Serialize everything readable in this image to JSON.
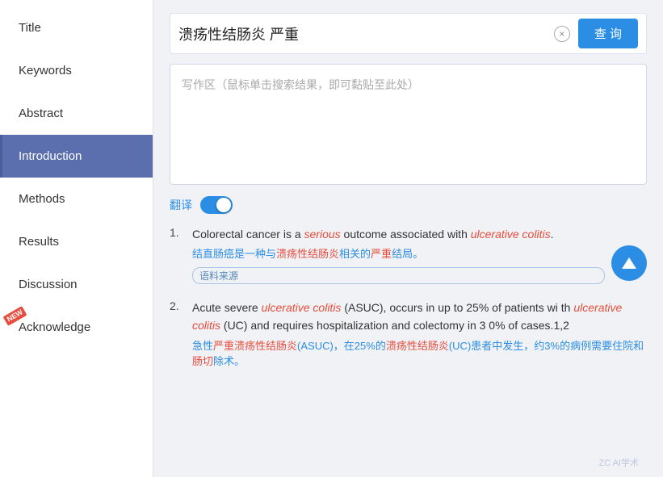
{
  "sidebar": {
    "items": [
      {
        "id": "title",
        "label": "Title",
        "active": false,
        "new": false
      },
      {
        "id": "keywords",
        "label": "Keywords",
        "active": false,
        "new": false
      },
      {
        "id": "abstract",
        "label": "Abstract",
        "active": false,
        "new": false
      },
      {
        "id": "introduction",
        "label": "Introduction",
        "active": true,
        "new": false
      },
      {
        "id": "methods",
        "label": "Methods",
        "active": false,
        "new": false
      },
      {
        "id": "results",
        "label": "Results",
        "active": false,
        "new": false
      },
      {
        "id": "discussion",
        "label": "Discussion",
        "active": false,
        "new": false
      },
      {
        "id": "acknowledge",
        "label": "Acknowledge",
        "active": false,
        "new": true
      }
    ]
  },
  "search": {
    "query": "溃疡性结肠炎 严重",
    "clear_label": "×",
    "query_btn_label": "查 询",
    "writing_placeholder": "写作区（鼠标单击搜索结果，即可黏贴至此处）"
  },
  "translate": {
    "label": "翻译"
  },
  "results": [
    {
      "number": "1.",
      "en_parts": [
        {
          "text": "Colorectal cancer is a ",
          "type": "normal"
        },
        {
          "text": "serious",
          "type": "em-serious"
        },
        {
          "text": " outcome associated with ",
          "type": "normal"
        },
        {
          "text": "ulcerative colitis",
          "type": "em-uc"
        },
        {
          "text": ".",
          "type": "normal"
        }
      ],
      "en_full": "Colorectal cancer is a serious outcome associated with ulcerative colitis.",
      "zh": "结直肠癌是一种与溃疡性结肠炎相关的严重结局。",
      "source": "语料来源"
    },
    {
      "number": "2.",
      "en_parts": [
        {
          "text": "Acute severe ",
          "type": "normal"
        },
        {
          "text": "ulcerative colitis",
          "type": "em-uc"
        },
        {
          "text": " (ASUC), occurs in up to 25% of patients with ",
          "type": "normal"
        },
        {
          "text": "ulcerative colitis",
          "type": "em-uc"
        },
        {
          "text": " (UC) and requires hospitalization and colectomy in 30% of cases.1,2",
          "type": "normal"
        }
      ],
      "en_full": "Acute severe ulcerative colitis (ASUC), occurs in up to 25% of patients with ulcerative colitis (UC) and requires hospitalization and colectomy in 30% of cases.1,2",
      "zh": "急性严重溃疡性结肠炎(ASUC)，在25%的溃疡性结肠炎(UC)患者中发生，约3%的病例需要住院和肠切除术。",
      "source": ""
    }
  ],
  "watermark": "ZC AI学术",
  "colors": {
    "accent": "#2b8de3",
    "active_sidebar": "#5b6eae",
    "em_red": "#e74c3c",
    "badge_red": "#e74c3c"
  }
}
